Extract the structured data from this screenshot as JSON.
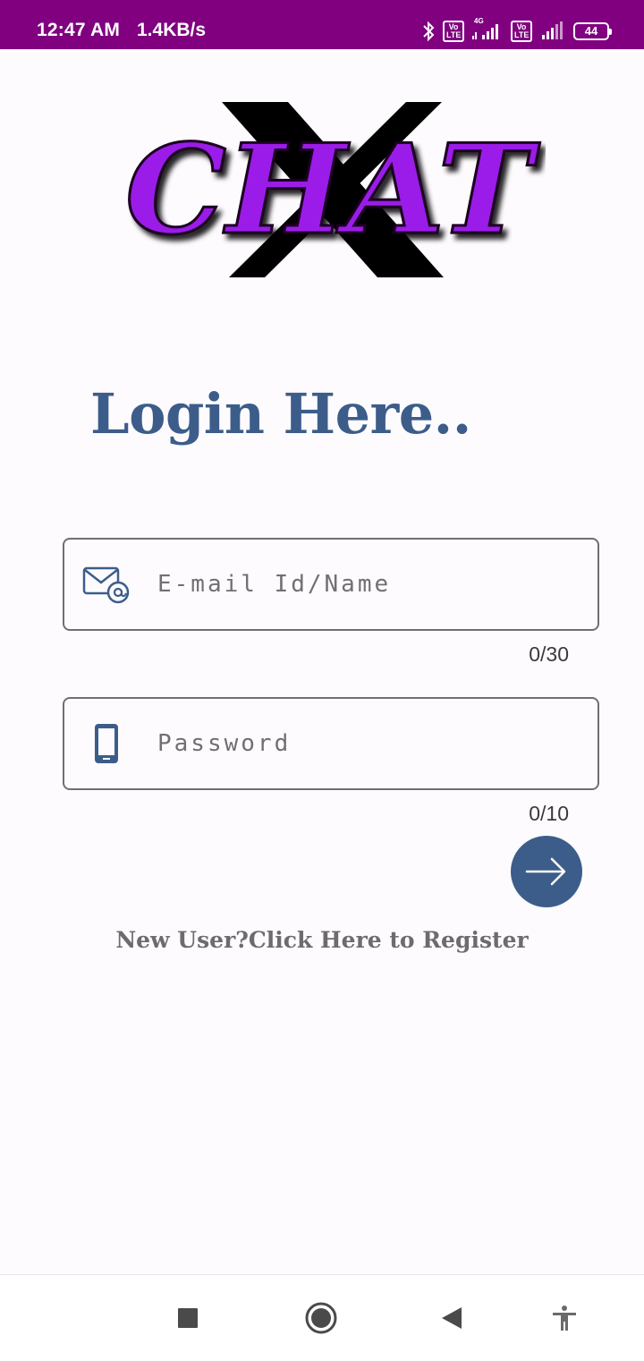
{
  "status_bar": {
    "time": "12:47 AM",
    "network_speed": "1.4KB/s",
    "volte_label": "Vo LTE",
    "network_type": "4G",
    "battery_level": "44",
    "icons": [
      "bluetooth-icon",
      "volte-icon",
      "signal-icon",
      "volte-icon",
      "signal-icon",
      "battery-icon"
    ]
  },
  "logo": {
    "text": "CHAT",
    "letter": "X",
    "colors": {
      "text": "#9b1ee8",
      "letter": "#000000"
    }
  },
  "login": {
    "title": "Login Here.."
  },
  "email_field": {
    "icon": "email-icon",
    "value": "",
    "placeholder": "E-mail Id/Name",
    "counter": "0/30"
  },
  "password_field": {
    "icon": "phone-icon",
    "value": "",
    "placeholder": "Password",
    "counter": "0/10"
  },
  "submit_button": {
    "icon": "arrow-right-icon"
  },
  "register": {
    "text": "New User?Click Here to Register"
  },
  "nav_bar": {
    "buttons": [
      "recents-square-icon",
      "home-circle-icon",
      "back-triangle-icon",
      "accessibility-icon"
    ]
  },
  "colors": {
    "status_bar": "#800080",
    "accent": "#3c5d8a",
    "background": "#fefbfe"
  }
}
